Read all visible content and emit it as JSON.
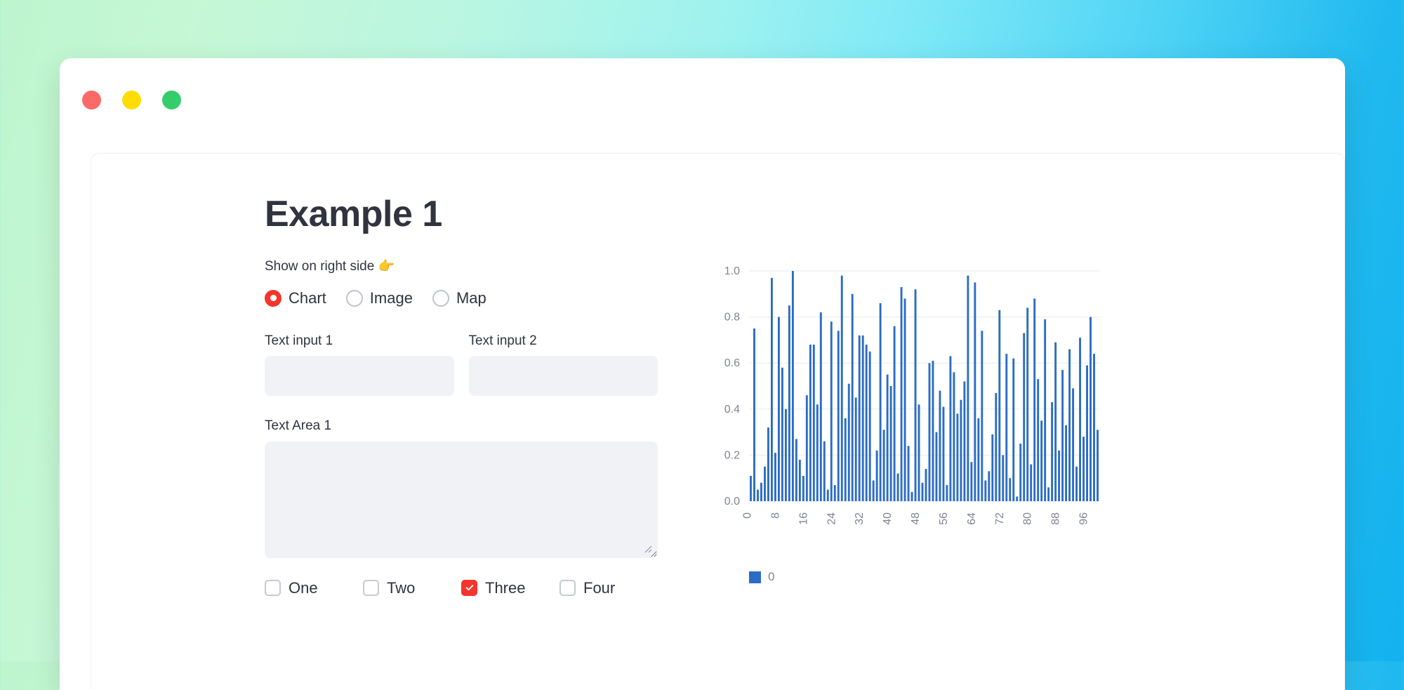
{
  "window": {
    "traffic_lights": [
      {
        "name": "close",
        "color": "#fc6a68"
      },
      {
        "name": "minimize",
        "color": "#ffdc04"
      },
      {
        "name": "maximize",
        "color": "#35cd6b"
      }
    ]
  },
  "page": {
    "title": "Example 1"
  },
  "form": {
    "radio_group": {
      "label": "Show on right side 👉",
      "options": [
        {
          "label": "Chart",
          "selected": true
        },
        {
          "label": "Image",
          "selected": false
        },
        {
          "label": "Map",
          "selected": false
        }
      ],
      "accent_color": "#f5352b"
    },
    "text_input_1": {
      "label": "Text input 1",
      "value": "",
      "placeholder": ""
    },
    "text_input_2": {
      "label": "Text input 2",
      "value": "",
      "placeholder": ""
    },
    "text_area_1": {
      "label": "Text Area 1",
      "value": "",
      "placeholder": ""
    },
    "checkboxes": [
      {
        "label": "One",
        "checked": false
      },
      {
        "label": "Two",
        "checked": false
      },
      {
        "label": "Three",
        "checked": true
      },
      {
        "label": "Four",
        "checked": false
      }
    ]
  },
  "chart_data": {
    "type": "bar",
    "title": "",
    "xlabel": "",
    "ylabel": "",
    "ylim": [
      0.0,
      1.0
    ],
    "xlim": [
      -0.5,
      99.5
    ],
    "grid": true,
    "legend": {
      "position": "bottom-left",
      "entries": [
        {
          "name": "0",
          "color": "#2b6cc4"
        }
      ]
    },
    "ytick_labels": [
      "0.0",
      "0.2",
      "0.4",
      "0.6",
      "0.8",
      "1.0"
    ],
    "ytick_values": [
      0.0,
      0.2,
      0.4,
      0.6,
      0.8,
      1.0
    ],
    "xtick_labels": [
      "0",
      "8",
      "16",
      "24",
      "32",
      "40",
      "48",
      "56",
      "64",
      "72",
      "80",
      "88",
      "96"
    ],
    "xtick_values": [
      0,
      8,
      16,
      24,
      32,
      40,
      48,
      56,
      64,
      72,
      80,
      88,
      96
    ],
    "series": [
      {
        "name": "0",
        "color": "#2b6cc4",
        "values": [
          0.11,
          0.75,
          0.05,
          0.08,
          0.15,
          0.32,
          0.97,
          0.21,
          0.8,
          0.58,
          0.4,
          0.85,
          1.0,
          0.27,
          0.18,
          0.11,
          0.46,
          0.68,
          0.68,
          0.42,
          0.82,
          0.26,
          0.05,
          0.78,
          0.07,
          0.74,
          0.98,
          0.36,
          0.51,
          0.9,
          0.45,
          0.72,
          0.72,
          0.68,
          0.65,
          0.09,
          0.22,
          0.86,
          0.31,
          0.55,
          0.5,
          0.76,
          0.12,
          0.93,
          0.88,
          0.24,
          0.04,
          0.92,
          0.42,
          0.08,
          0.14,
          0.6,
          0.61,
          0.3,
          0.48,
          0.41,
          0.07,
          0.63,
          0.56,
          0.38,
          0.44,
          0.52,
          0.98,
          0.17,
          0.95,
          0.36,
          0.74,
          0.09,
          0.13,
          0.29,
          0.47,
          0.83,
          0.2,
          0.64,
          0.1,
          0.62,
          0.02,
          0.25,
          0.73,
          0.84,
          0.16,
          0.88,
          0.53,
          0.35,
          0.79,
          0.06,
          0.43,
          0.69,
          0.22,
          0.57,
          0.33,
          0.66,
          0.49,
          0.15,
          0.71,
          0.28,
          0.59,
          0.8,
          0.64,
          0.31
        ]
      }
    ]
  }
}
